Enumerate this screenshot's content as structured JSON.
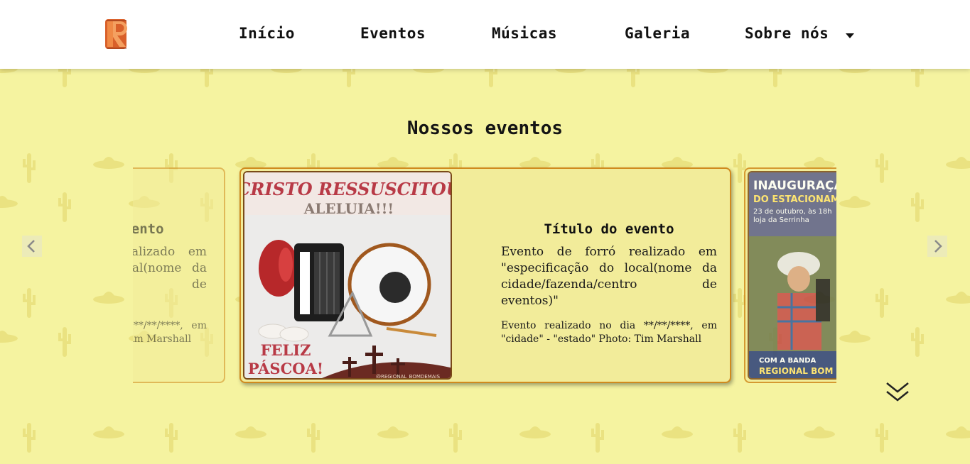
{
  "header": {
    "logo_alt": "R",
    "nav": [
      {
        "label": "Início"
      },
      {
        "label": "Eventos"
      },
      {
        "label": "Músicas"
      },
      {
        "label": "Galeria"
      },
      {
        "label": "Sobre nós"
      }
    ]
  },
  "section": {
    "title": "Nossos eventos"
  },
  "cards": [
    {
      "title": "Título do evento",
      "description": "Evento de forró realizado em \"especificação do local(nome da cidade/fazenda/centro de eventos)\"",
      "date_text": "Evento realizado no dia **/**/****, em \"cidade\" - \"estado\" Photo: Tim Marshall"
    },
    {
      "title": "Título do evento",
      "description": "Evento de forró realizado em \"especificação do local(nome da cidade/fazenda/centro de eventos)\"",
      "date_text": "Evento realizado no dia **/**/****, em \"cidade\" - \"estado\" Photo: Tim Marshall",
      "poster": {
        "headline": "CRISTO RESSUSCITOU",
        "subline": "ALELUIA!!!",
        "footer1": "FELIZ",
        "footer2": "PÁSCOA!",
        "credit": "@REGIONAL_BOMDEMAIS"
      }
    },
    {
      "poster": {
        "headline": "INAUGURAÇÃO",
        "subline": "DO ESTACIONAMENTO",
        "date": "23 de outubro, às 18h",
        "place": "loja da Serrinha",
        "footer1": "COM A BANDA",
        "footer2": "REGIONAL BOM DE MAIS"
      }
    }
  ],
  "colors": {
    "page_bg": "#f5f3a0",
    "card_bg": "#f2ec9a",
    "card_border": "#d08a1e",
    "logo": "#d9602a"
  },
  "icons": {
    "prev": "chevron-left-icon",
    "next": "chevron-right-icon",
    "dropdown": "caret-down-icon",
    "scroll": "double-chevron-down-icon"
  }
}
